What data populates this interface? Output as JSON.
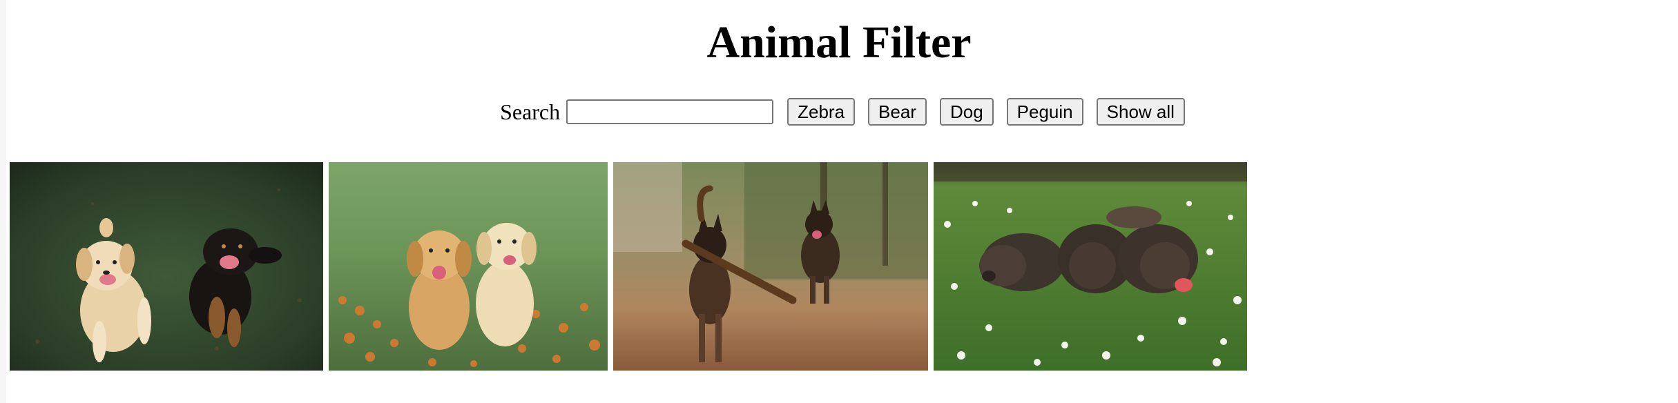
{
  "page": {
    "title": "Animal Filter"
  },
  "search": {
    "label": "Search",
    "value": "",
    "placeholder": ""
  },
  "filters": [
    {
      "label": "Zebra"
    },
    {
      "label": "Bear"
    },
    {
      "label": "Dog"
    },
    {
      "label": "Peguin"
    },
    {
      "label": "Show all"
    }
  ],
  "gallery": {
    "images": [
      {
        "name": "photo-two-dogs-on-grass",
        "subject": "dog"
      },
      {
        "name": "photo-two-golden-puppies",
        "subject": "dog"
      },
      {
        "name": "photo-shepherd-dogs-with-stick",
        "subject": "dog"
      },
      {
        "name": "photo-three-chocolate-puppies",
        "subject": "dog"
      }
    ]
  },
  "colors": {
    "button_bg": "#efefef",
    "button_border": "#767676",
    "page_bg": "#ffffff"
  }
}
